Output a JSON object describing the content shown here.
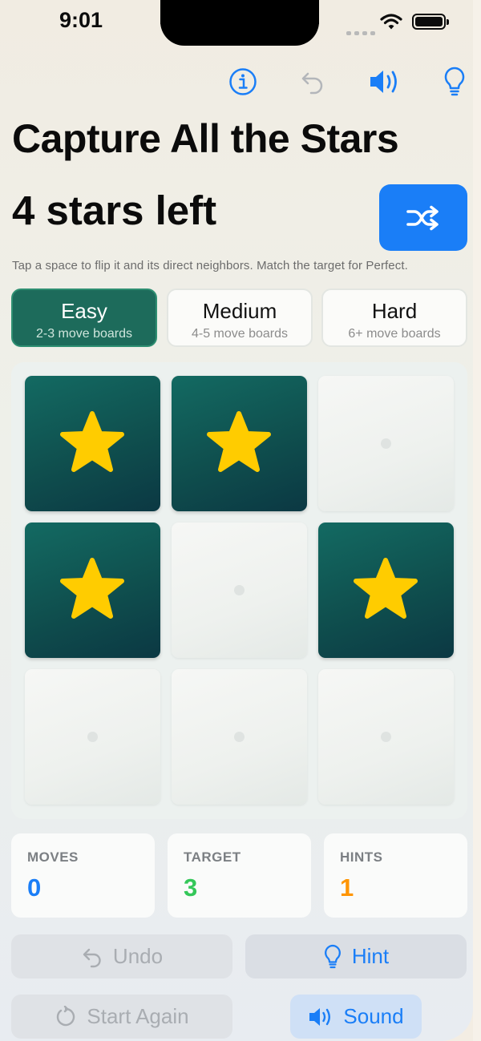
{
  "status_bar": {
    "time": "9:01"
  },
  "toolbar": {
    "info_icon": "info-circle-icon",
    "undo_icon": "undo-arrow-icon",
    "sound_icon": "speaker-wave-icon",
    "hint_icon": "lightbulb-icon"
  },
  "header": {
    "title": "Capture All the Stars",
    "stars_left": "4 stars left",
    "shuffle_icon": "shuffle-icon"
  },
  "instructions": "Tap a space to flip it and its direct neighbors. Match the target for Perfect.",
  "difficulty": [
    {
      "name": "Easy",
      "sub": "2-3 move boards",
      "selected": true
    },
    {
      "name": "Medium",
      "sub": "4-5 move boards",
      "selected": false
    },
    {
      "name": "Hard",
      "sub": "6+ move boards",
      "selected": false
    }
  ],
  "board": {
    "rows": 3,
    "cols": 3,
    "cells": [
      [
        true,
        true,
        false
      ],
      [
        true,
        false,
        true
      ],
      [
        false,
        false,
        false
      ]
    ]
  },
  "stats": {
    "moves": {
      "label": "MOVES",
      "value": "0"
    },
    "target": {
      "label": "TARGET",
      "value": "3"
    },
    "hints": {
      "label": "HINTS",
      "value": "1"
    }
  },
  "actions": {
    "undo": "Undo",
    "hint": "Hint",
    "start_again": "Start Again",
    "sound": "Sound"
  },
  "colors": {
    "accent_blue": "#1a7ef7",
    "teal_selected": "#1d6b5b",
    "star_yellow": "#ffcc00",
    "moves_blue": "#1a7ef7",
    "target_green": "#34c759",
    "hints_orange": "#ff9500"
  }
}
